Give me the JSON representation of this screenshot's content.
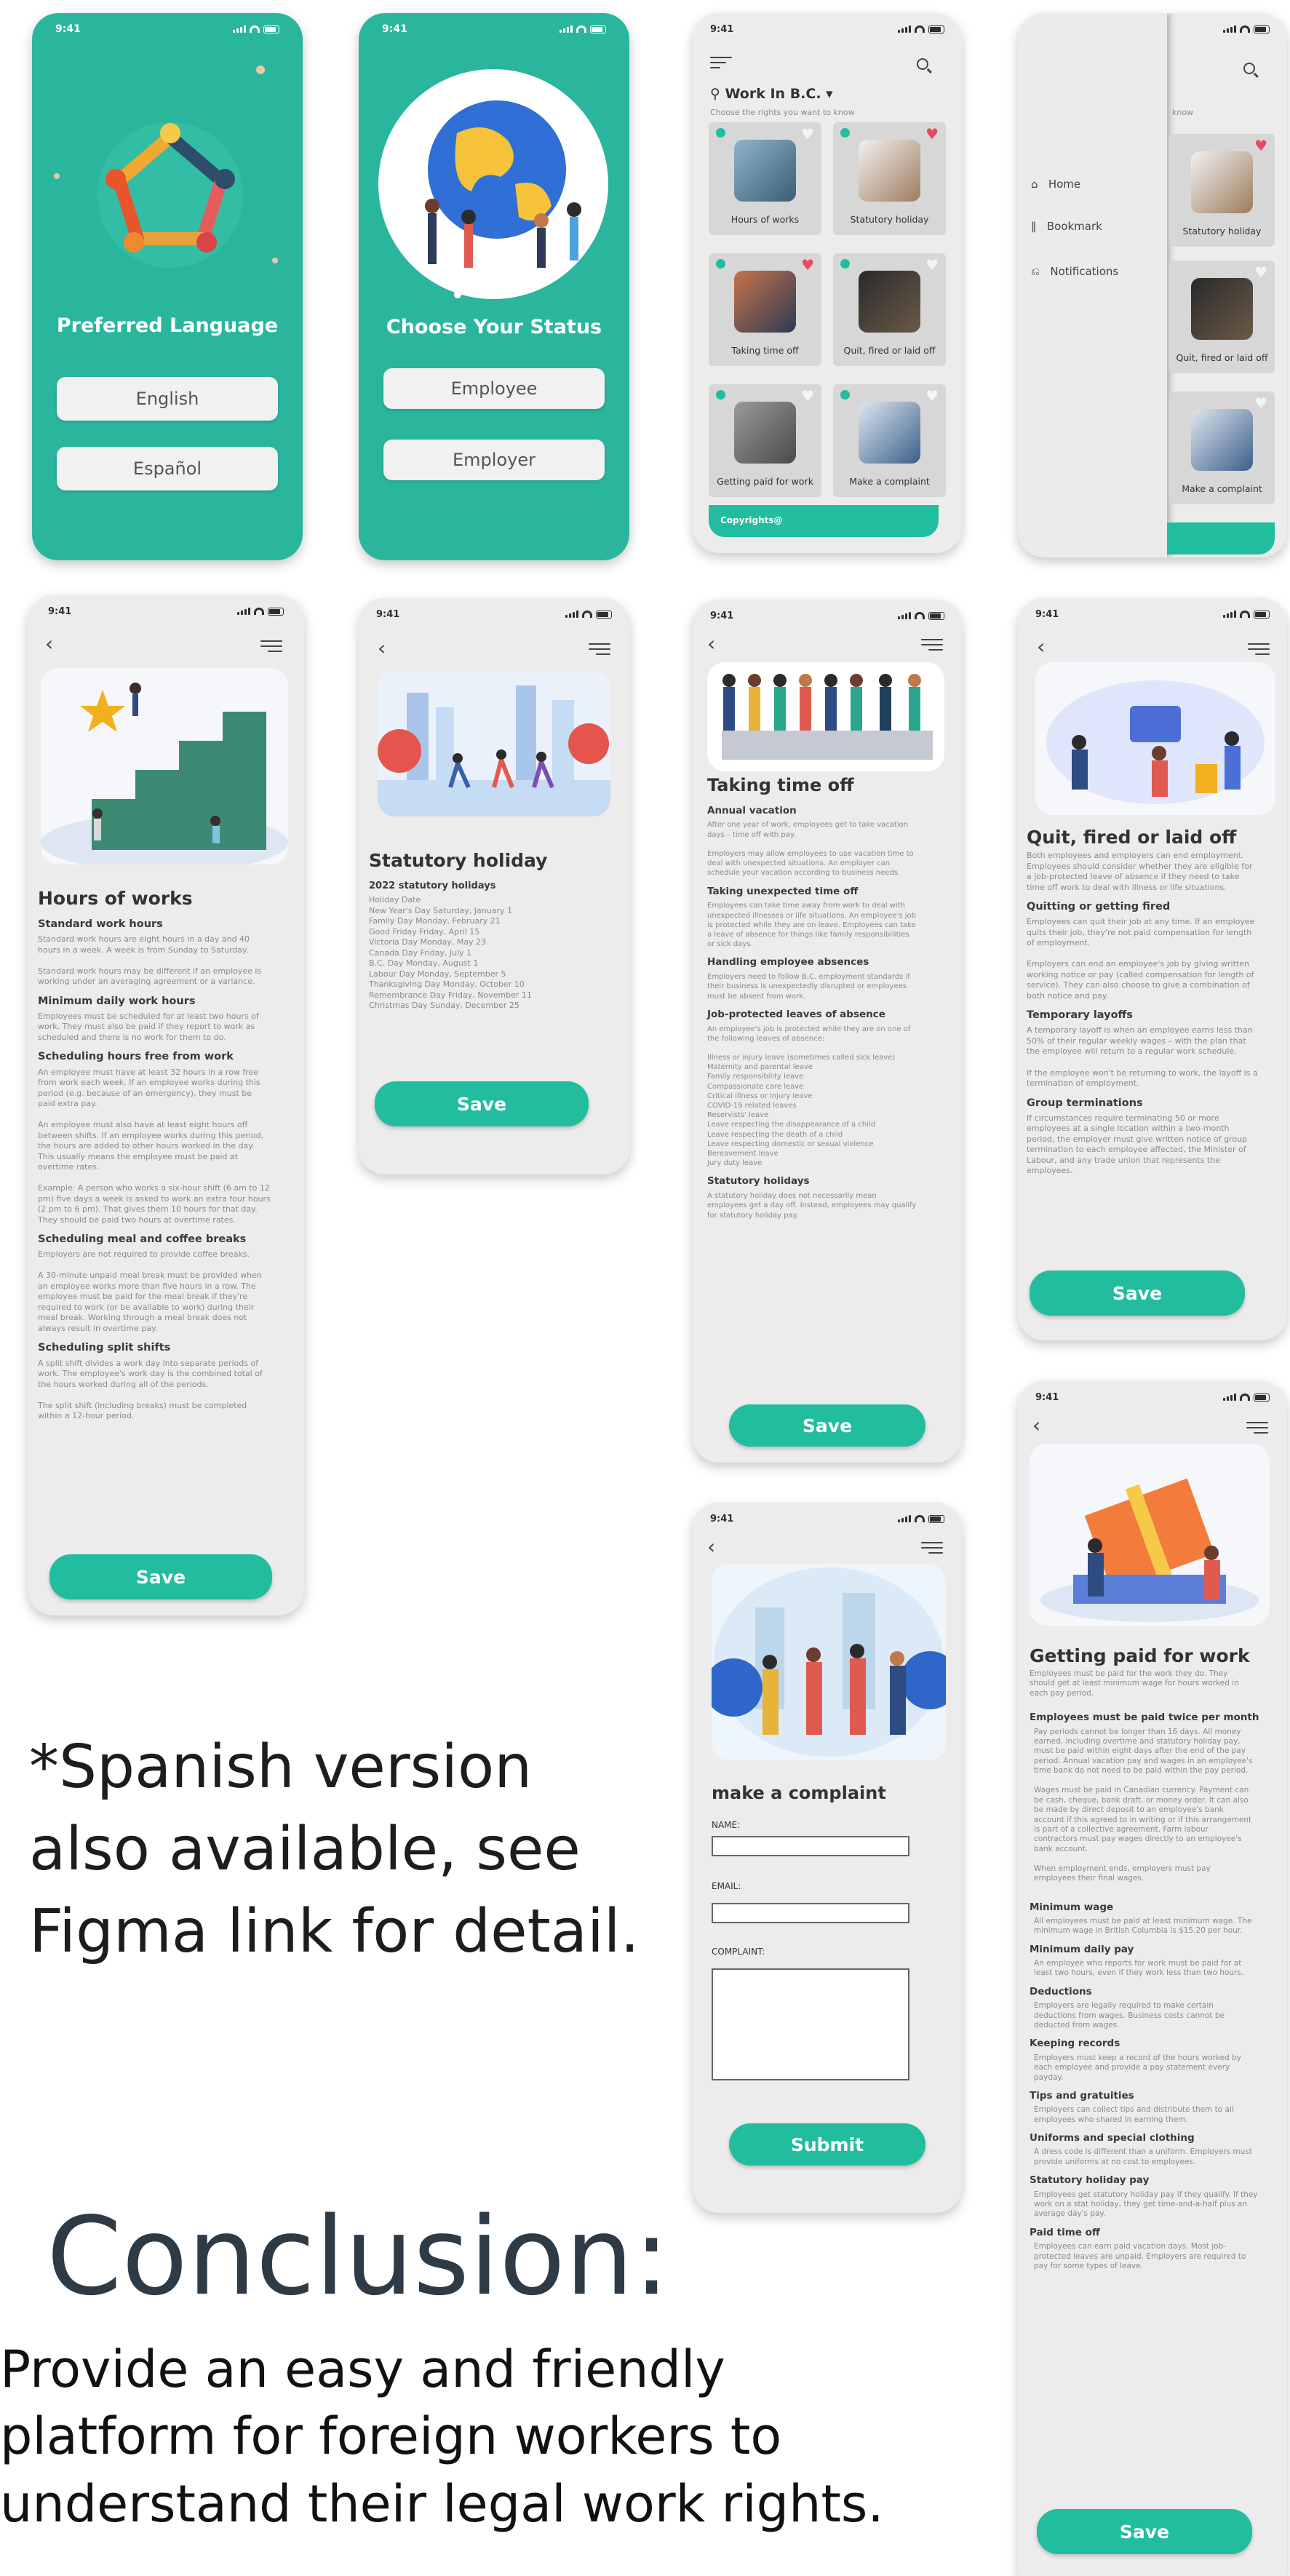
{
  "status_time": "9:41",
  "language_screen": {
    "title": "Preferred Language",
    "options": [
      "English",
      "Español"
    ]
  },
  "status_screen": {
    "title": "Choose Your Status",
    "options": [
      "Employee",
      "Employer"
    ]
  },
  "home_screen": {
    "location": "Work In B.C.",
    "subtitle": "Choose the rights you want to know",
    "cards": [
      {
        "label": "Hours of works",
        "liked": false
      },
      {
        "label": "Statutory holiday",
        "liked": true
      },
      {
        "label": "Taking time off",
        "liked": true
      },
      {
        "label": "Quit, fired or laid off",
        "liked": false
      },
      {
        "label": "Getting paid for work",
        "liked": false
      },
      {
        "label": "Make a complaint",
        "liked": false
      }
    ],
    "footer": "Copyrights@"
  },
  "menu_screen": {
    "partial_subtitle": "know",
    "items": [
      "Home",
      "Bookmark",
      "Notifications"
    ],
    "cards": [
      "Statutory holiday",
      "Quit, fired or laid off",
      "Make a complaint"
    ]
  },
  "hours_screen": {
    "title": "Hours of works",
    "sections": [
      {
        "h": "Standard work hours",
        "p": "Standard work hours are eight hours in a day and 40\nhours in a week. A week is from Sunday to Saturday.\n\nStandard work hours may be different if an employee is\nworking under an averaging agreement or a variance."
      },
      {
        "h": "Minimum daily work hours",
        "p": "Employees must be scheduled for at least two hours of\nwork. They must also be paid if they report to work as\nscheduled and there is no work for them to do."
      },
      {
        "h": "Scheduling hours free from work",
        "p": "An employee must have at least 32 hours in a row free\nfrom work each week. If an employee works during this\nperiod (e.g. because of an emergency), they must be\npaid extra pay.\n\nAn employee must also have at least eight hours off\nbetween shifts. If an employee works during this period,\nthe hours are added to other hours worked in the day.\nThis usually means the employee must be paid at\novertime rates.\n\nExample: A person who works a six-hour shift (6 am to 12\npm) five days a week is asked to work an extra four hours\n(2 pm to 6 pm). That gives them 10 hours for that day.\nThey should be paid two hours at overtime rates."
      },
      {
        "h": "Scheduling meal and coffee breaks",
        "p": "Employers are not required to provide coffee breaks.\n\nA 30-minute unpaid meal break must be provided when\nan employee works more than five hours in a row. The\nemployee must be paid for the meal break if they're\nrequired to work (or be available to work) during their\nmeal break. Working through a meal break does not\nalways result in overtime pay."
      },
      {
        "h": "Scheduling split shifts",
        "p": "A split shift divides a work day into separate periods of\nwork. The employee's work day is the combined total of\nthe hours worked during all of the periods.\n\nThe split shift (including breaks) must be completed\nwithin a 12-hour period."
      }
    ],
    "save": "Save"
  },
  "holiday_screen": {
    "title": "Statutory holiday",
    "subhead": "2022 statutory holidays",
    "lines": [
      "Holiday Date",
      "New Year's Day Saturday, January 1",
      "Family Day Monday, February 21",
      "Good Friday Friday, April 15",
      "Victoria Day Monday, May 23",
      "Canada Day Friday, July 1",
      "B.C. Day Monday, August 1",
      "Labour Day Monday, September 5",
      "Thanksgiving Day Monday, October 10",
      "Remembrance Day Friday, November 11",
      "Christmas Day Sunday, December 25"
    ],
    "save": "Save"
  },
  "timeoff_screen": {
    "title": "Taking time off",
    "sections": [
      {
        "h": "Annual vacation",
        "p": "After one year of work, employees get to take vacation\ndays – time off with pay.\n\nEmployers may allow employees to use vacation time to\ndeal with unexpected situations. An employer can\nschedule your vacation according to business needs."
      },
      {
        "h": "Taking unexpected time off",
        "p": "Employees can take time away from work to deal with\nunexpected illnesses or life situations. An employee's job\nis protected while they are on leave. Employees can take\na leave of absence for things like family responsibilities\nor sick days."
      },
      {
        "h": "Handling employee absences",
        "p": "Employers need to follow B.C. employment standards if\ntheir business is unexpectedly disrupted or employees\nmust be absent from work."
      },
      {
        "h": "Job-protected leaves of absence",
        "p": "An employee's job is protected while they are on one of\nthe following leaves of absence:\n\nIllness or injury leave (sometimes called sick leave)\nMaternity and parental leave\nFamily responsibility leave\nCompassionate care leave\nCritical illness or injury leave\nCOVID-19 related leaves\nReservists' leave\nLeave respecting the disappearance of a child\nLeave respecting the death of a child\nLeave respecting domestic or sexual violence\nBereavement leave\nJury duty leave"
      },
      {
        "h": "Statutory holidays",
        "p": "A statutory holiday does not necessarily mean\nemployees get a day off. Instead, employees may qualify\nfor statutory holiday pay."
      }
    ],
    "save": "Save"
  },
  "quit_screen": {
    "title": "Quit, fired or laid off",
    "intro": "Both employees and employers can end employment.\nEmployees should consider whether they are eligible for\na job-protected leave of absence if they need to take\ntime off work to deal with illness or life situations.",
    "sections": [
      {
        "h": "Quitting or getting fired",
        "p": "Employees can quit their job at any time. If an employee\nquits their job, they're not paid compensation for length\nof employment.\n\nEmployers can end an employee's job by giving written\nworking notice or pay (called compensation for length of\nservice). They can also choose to give a combination of\nboth notice and pay."
      },
      {
        "h": "Temporary layoffs",
        "p": "A temporary layoff is when an employee earns less than\n50% of their regular weekly wages – with the plan that\nthe employee will return to a regular work schedule.\n\nIf the employee won't be returning to work, the layoff is a\ntermination of employment."
      },
      {
        "h": "Group terminations",
        "p": "If circumstances require terminating 50 or more\nemployees at a single location within a two-month\nperiod, the employer must give written notice of group\ntermination to each employee affected, the Minister of\nLabour, and any trade union that represents the\nemployees."
      }
    ],
    "save": "Save"
  },
  "complaint_screen": {
    "title": "make a complaint",
    "fields": [
      "NAME:",
      "EMAIL:",
      "COMPLAINT:"
    ],
    "submit": "Submit"
  },
  "paid_screen": {
    "title": "Getting paid for work",
    "intro": "Employees must be paid for the work they do. They\nshould get at least minimum wage for hours worked in\neach pay period.",
    "sections": [
      {
        "h": "Employees must be paid twice per month",
        "p": "Pay periods cannot be longer than 16 days. All money\nearned, including overtime and statutory holiday pay,\nmust be paid within eight days after the end of the pay\nperiod. Annual vacation pay and wages in an employee's\ntime bank do not need to be paid within the pay period.\n\nWages must be paid in Canadian currency. Payment can\nbe cash, cheque, bank draft, or money order. It can also\nbe made by direct deposit to an employee's bank\naccount if this agreed to in writing or if this arrangement\nis part of a collective agreement. Farm labour\ncontractors must pay wages directly to an employee's\nbank account.\n\nWhen employment ends, employers must pay\nemployees their final wages."
      },
      {
        "h": "Minimum wage",
        "p": "All employees must be paid at least minimum wage. The\nminimum wage in British Columbia is $15.20 per hour."
      },
      {
        "h": "Minimum daily pay",
        "p": "An employee who reports for work must be paid for at\nleast two hours, even if they work less than two hours."
      },
      {
        "h": "Deductions",
        "p": "Employers are legally required to make certain\ndeductions from wages. Business costs cannot be\ndeducted from wages."
      },
      {
        "h": "Keeping records",
        "p": "Employers must keep a record of the hours worked by\neach employee and provide a pay statement every\npayday."
      },
      {
        "h": "Tips and gratuities",
        "p": "Employers can collect tips and distribute them to all\nemployees who shared in earning them."
      },
      {
        "h": "Uniforms and special clothing",
        "p": "A dress code is different than a uniform. Employers must\nprovide uniforms at no cost to employees."
      },
      {
        "h": "Statutory holiday pay",
        "p": "Employees get statutory holiday pay if they qualify. If they\nwork on a stat holiday, they get time-and-a-half plus an\naverage day's pay."
      },
      {
        "h": "Paid time off",
        "p": "Employees can earn paid vacation days. Most job-\nprotected leaves are unpaid. Employers are required to\npay for some types of leave."
      }
    ],
    "save": "Save"
  },
  "note": "*Spanish version\nalso available, see\nFigma link for detail.",
  "conclusion": {
    "heading": "Conclusion:",
    "body": "Provide an easy and friendly\nplatform for foreign workers to\nunderstand their legal work rights."
  },
  "colors": {
    "teal": "#2ab69d",
    "button": "#22bd9f",
    "heart": "#e84a5f"
  }
}
